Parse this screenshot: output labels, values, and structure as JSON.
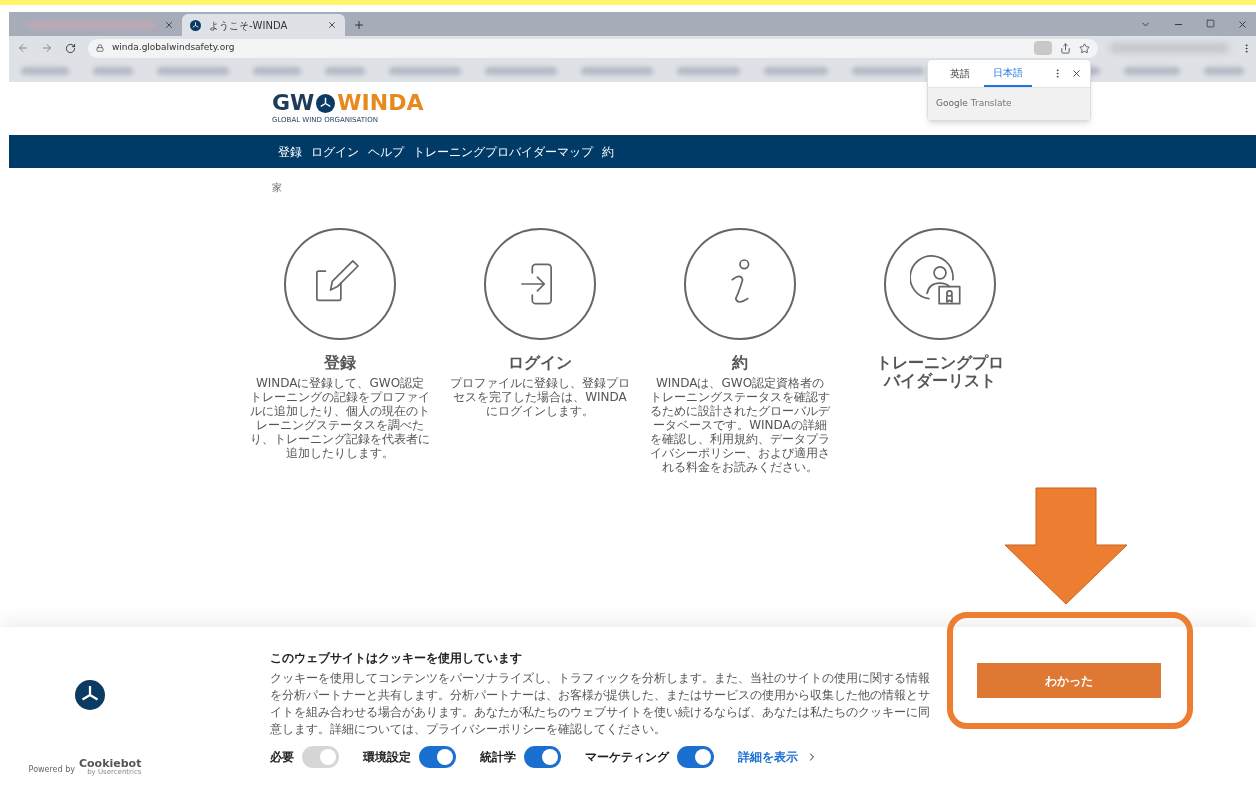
{
  "browser": {
    "tabs": [
      {
        "selected": false
      },
      {
        "label": "ようこそ-WINDA",
        "selected": true
      }
    ],
    "address": "winda.globalwindsafety.org"
  },
  "translate_popup": {
    "tabs": [
      {
        "label": "英語",
        "selected": false
      },
      {
        "label": "日本語",
        "selected": true
      }
    ],
    "brand": "Google",
    "product": "Translate"
  },
  "logo": {
    "left": "GW",
    "right": "WINDA",
    "tagline": "GLOBAL WIND ORGANISATION"
  },
  "nav": [
    "登録",
    "ログイン",
    "ヘルプ",
    "トレーニングプロバイダーマップ",
    "約"
  ],
  "breadcrumb": "家",
  "cards": [
    {
      "kind": "edit",
      "title": "登録",
      "description": "WINDAに登録して、GWO認定トレーニングの記録をプロファイルに追加したり、個人の現在のトレーニングステータスを調べたり、トレーニング記録を代表者に追加したりします。"
    },
    {
      "kind": "login",
      "title": "ログイン",
      "description": "プロファイルに登録し、登録プロセスを完了した場合は、WINDAにログインします。"
    },
    {
      "kind": "info",
      "title": "約",
      "description": "WINDAは、GWO認定資格者のトレーニングステータスを確認するために設計されたグローバルデータベースです。WINDAの詳細を確認し、利用規約、データプライバシーポリシー、および適用される料金をお読みください。"
    },
    {
      "kind": "certificate",
      "title": "トレーニングプロバイダーリスト"
    }
  ],
  "cookie": {
    "title": "このウェブサイトはクッキーを使用しています",
    "body": "クッキーを使用してコンテンツをパーソナライズし、トラフィックを分析します。また、当社のサイトの使用に関する情報を分析パートナーと共有します。分析パートナーは、お客様が提供した、またはサービスの使用から収集した他の情報とサイトを組み合わせる場合があります。あなたが私たちのウェブサイトを使い続けるならば、あなたは私たちのクッキーに同意します。詳細については、プライバシーポリシーを確認してください。",
    "button": "わかった",
    "powered_by": "Powered by",
    "brand": "Cookiebot",
    "brand_sub": "by Usercentrics",
    "toggles": [
      {
        "label": "必要",
        "on": true,
        "disabled": true
      },
      {
        "label": "環境設定",
        "on": true,
        "disabled": false
      },
      {
        "label": "統計学",
        "on": true,
        "disabled": false
      },
      {
        "label": "マーケティング",
        "on": true,
        "disabled": false
      }
    ],
    "details_link": "詳細を表示"
  }
}
